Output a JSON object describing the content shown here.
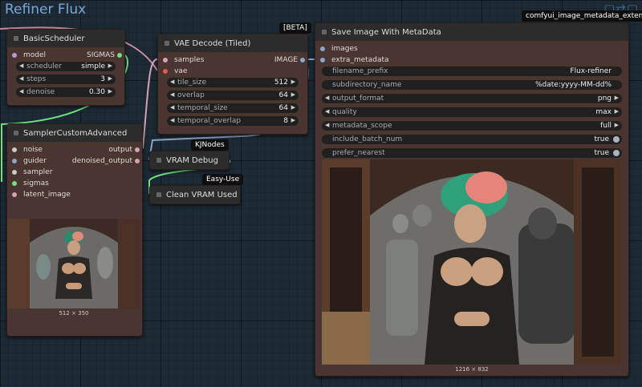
{
  "group": {
    "title": "Refiner Flux"
  },
  "badges": {
    "beta": "[BETA]",
    "metadata_ext": "comfyui_image_metadata_exten...",
    "kjnodes": "KJNodes",
    "easyuse": "Easy-Use"
  },
  "basic_scheduler": {
    "title": "BasicScheduler",
    "input_model": "model",
    "output_sigmas": "SIGMAS",
    "scheduler_label": "scheduler",
    "scheduler_value": "simple",
    "steps_label": "steps",
    "steps_value": "3",
    "denoise_label": "denoise",
    "denoise_value": "0.30"
  },
  "vae_decode": {
    "title": "VAE Decode (Tiled)",
    "input_samples": "samples",
    "input_vae": "vae",
    "output_image": "IMAGE",
    "tile_size_label": "tile_size",
    "tile_size_value": "512",
    "overlap_label": "overlap",
    "overlap_value": "64",
    "temporal_size_label": "temporal_size",
    "temporal_size_value": "64",
    "temporal_overlap_label": "temporal_overlap",
    "temporal_overlap_value": "8"
  },
  "sampler": {
    "title": "SamplerCustomAdvanced",
    "inputs": [
      "noise",
      "guider",
      "sampler",
      "sigmas",
      "latent_image"
    ],
    "outputs": [
      "output",
      "denoised_output"
    ],
    "preview_caption": "512 × 350"
  },
  "vram_debug": {
    "title": "VRAM Debug"
  },
  "clean_vram": {
    "title": "Clean VRAM Used"
  },
  "save_image": {
    "title": "Save Image With MetaData",
    "input_images": "images",
    "input_extra_metadata": "extra_metadata",
    "filename_prefix_label": "filename_prefix",
    "filename_prefix_value": "Flux-refiner",
    "subdirectory_label": "subdirectory_name",
    "subdirectory_value": "%date:yyyy-MM-dd%",
    "output_format_label": "output_format",
    "output_format_value": "png",
    "quality_label": "quality",
    "quality_value": "max",
    "metadata_scope_label": "metadata_scope",
    "metadata_scope_value": "full",
    "include_batch_label": "include_batch_num",
    "include_batch_value": "true",
    "prefer_nearest_label": "prefer_nearest",
    "prefer_nearest_value": "true",
    "preview_caption": "1216 × 832"
  },
  "colors": {
    "node_body": "#4a3530",
    "node_head": "#2c2c2c",
    "wire_model": "#c98a9a",
    "wire_sigmas": "#6ee07e",
    "wire_image": "#8aa5c8",
    "wire_misc": "#d8a0b4"
  }
}
